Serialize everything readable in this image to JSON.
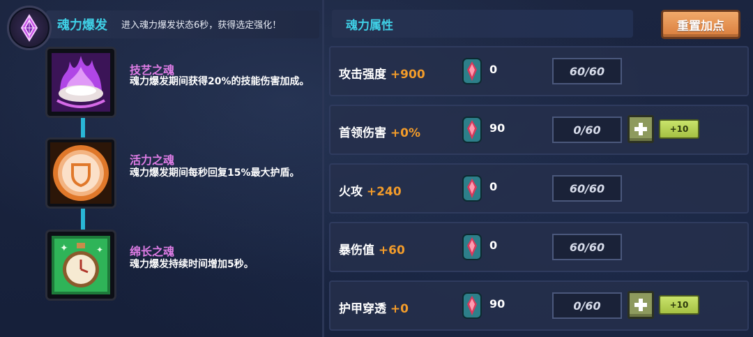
{
  "burst": {
    "title": "魂力爆发",
    "description": "进入魂力爆发状态6秒，获得选定强化！"
  },
  "souls": [
    {
      "name": "技艺之魂",
      "description": "魂力爆发期间获得20%的技能伤害加成。",
      "icon": "purple-flame-shell-icon"
    },
    {
      "name": "活力之魂",
      "description": "魂力爆发期间每秒回复15%最大护盾。",
      "icon": "orange-shield-orb-icon"
    },
    {
      "name": "绵长之魂",
      "description": "魂力爆发持续时间增加5秒。",
      "icon": "green-stopwatch-icon"
    }
  ],
  "attributes": {
    "title": "魂力属性",
    "reset_label": "重置加点",
    "rows": [
      {
        "name": "攻击强度",
        "bonus": "+900",
        "points": "0",
        "level": "60/60"
      },
      {
        "name": "首领伤害",
        "bonus": "+0%",
        "points": "90",
        "level": "0/60",
        "plus": "+",
        "plus10": "+10"
      },
      {
        "name": "火攻",
        "bonus": "+240",
        "points": "0",
        "level": "60/60"
      },
      {
        "name": "暴伤值",
        "bonus": "+60",
        "points": "0",
        "level": "60/60"
      },
      {
        "name": "护甲穿透",
        "bonus": "+0",
        "points": "90",
        "level": "0/60",
        "plus": "+",
        "plus10": "+10"
      }
    ]
  },
  "colors": {
    "accent_cyan": "#3fd0e6",
    "soul_name": "#df7de6",
    "bonus_orange": "#f39c2a",
    "reset_orange": "#e38d4a",
    "plus10_green": "#b8d35a"
  }
}
